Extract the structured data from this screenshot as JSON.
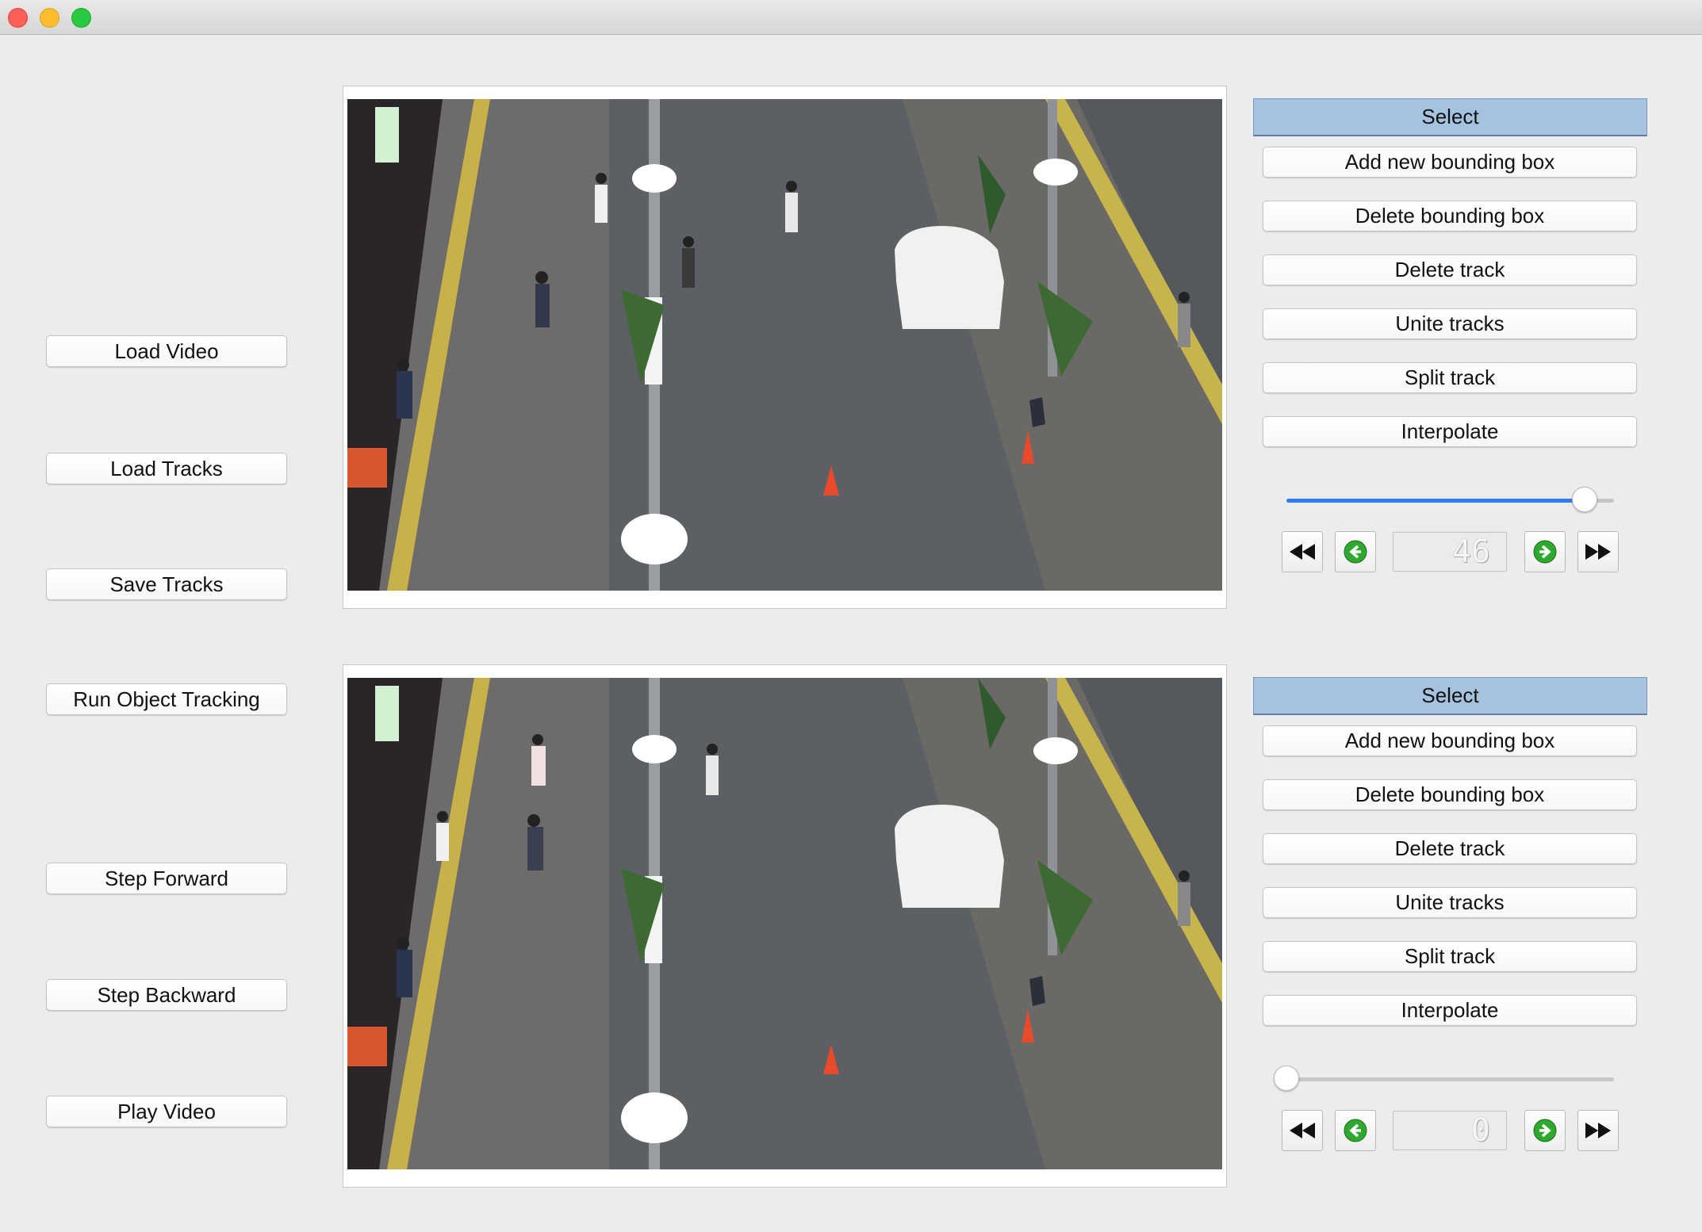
{
  "left_panel": {
    "buttons": [
      "Load Video",
      "Load Tracks",
      "Save Tracks",
      "Run Object Tracking",
      "Step Forward",
      "Step Backward",
      "Play Video"
    ]
  },
  "top_panel": {
    "select_label": "Select",
    "tools": [
      "Add new bounding box",
      "Delete bounding box",
      "Delete track",
      "Unite tracks",
      "Split track",
      "Interpolate"
    ],
    "slider_fraction": 0.91,
    "frame_number": "46"
  },
  "bottom_panel": {
    "select_label": "Select",
    "tools": [
      "Add new bounding box",
      "Delete bounding box",
      "Delete track",
      "Unite tracks",
      "Split track",
      "Interpolate"
    ],
    "slider_fraction": 0.0,
    "frame_number": "0"
  },
  "icons": {
    "first": "rewind-icon",
    "prev": "green-left-arrow-icon",
    "next": "green-right-arrow-icon",
    "last": "fast-forward-icon"
  },
  "colors": {
    "select_bg": "#a5c2de",
    "slider_accent": "#2d7cf6",
    "arrow_green": "#2ea82e"
  }
}
